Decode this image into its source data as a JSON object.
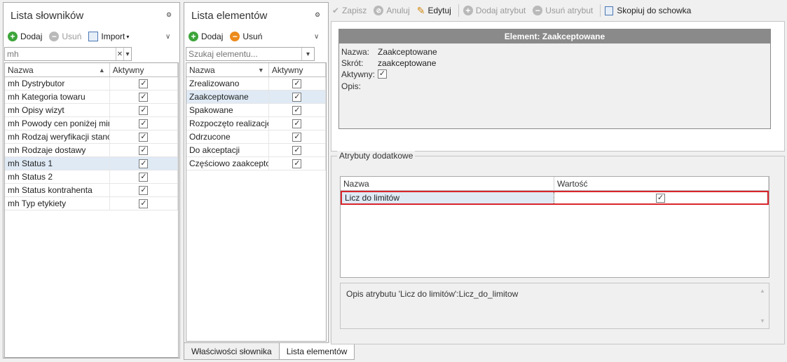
{
  "dict_panel": {
    "title": "Lista słowników",
    "toolbar": {
      "add_label": "Dodaj",
      "remove_label": "Usuń",
      "import_label": "Import"
    },
    "filter_value": "mh",
    "columns": [
      "Nazwa",
      "Aktywny"
    ],
    "rows": [
      {
        "name": "mh Dystrybutor",
        "active": true,
        "selected": false
      },
      {
        "name": "mh Kategoria towaru",
        "active": true,
        "selected": false
      },
      {
        "name": "mh Opisy wizyt",
        "active": true,
        "selected": false
      },
      {
        "name": "mh Powody cen poniżej mini...",
        "active": true,
        "selected": false
      },
      {
        "name": "mh Rodzaj weryfikacji stanów",
        "active": true,
        "selected": false
      },
      {
        "name": "mh Rodzaje dostawy",
        "active": true,
        "selected": false
      },
      {
        "name": "mh Status 1",
        "active": true,
        "selected": true
      },
      {
        "name": "mh Status 2",
        "active": true,
        "selected": false
      },
      {
        "name": "mh Status kontrahenta",
        "active": true,
        "selected": false
      },
      {
        "name": "mh Typ etykiety",
        "active": true,
        "selected": false
      }
    ]
  },
  "elem_panel": {
    "title": "Lista elementów",
    "toolbar": {
      "add_label": "Dodaj",
      "remove_label": "Usuń"
    },
    "search_placeholder": "Szukaj elementu...",
    "columns": [
      "Nazwa",
      "Aktywny"
    ],
    "rows": [
      {
        "name": "Zrealizowano",
        "active": true,
        "selected": false
      },
      {
        "name": "Zaakceptowane",
        "active": true,
        "selected": true
      },
      {
        "name": "Spakowane",
        "active": true,
        "selected": false
      },
      {
        "name": "Rozpoczęto realizacje",
        "active": true,
        "selected": false
      },
      {
        "name": "Odrzucone",
        "active": true,
        "selected": false
      },
      {
        "name": "Do akceptacji",
        "active": true,
        "selected": false
      },
      {
        "name": "Częściowo zaakcepto...",
        "active": true,
        "selected": false
      }
    ]
  },
  "tabs": [
    "Właściwości słownika",
    "Lista elementów"
  ],
  "main_toolbar": {
    "save": "Zapisz",
    "cancel": "Anuluj",
    "edit": "Edytuj",
    "add_attr": "Dodaj atrybut",
    "remove_attr": "Usuń atrybut",
    "copy": "Skopiuj do schowka"
  },
  "element": {
    "header": "Element: Zaakceptowane",
    "name_label": "Nazwa:",
    "name_value": "Zaakceptowane",
    "short_label": "Skrót:",
    "short_value": "zaakceptowane",
    "active_label": "Aktywny:",
    "active_value": true,
    "desc_label": "Opis:"
  },
  "attributes": {
    "group_title": "Atrybuty dodatkowe",
    "columns": [
      "Nazwa",
      "Wartość"
    ],
    "rows": [
      {
        "name": "Licz do limitów",
        "value": true
      }
    ],
    "description": "Opis atrybutu 'Licz do limitów':Licz_do_limitow"
  },
  "colors": {
    "selection": "#dfeaf5",
    "highlight_border": "#d9262c",
    "add_icon": "#3da53a",
    "remove_icon": "#ec8a1c",
    "element_header": "#8a8a8a"
  }
}
